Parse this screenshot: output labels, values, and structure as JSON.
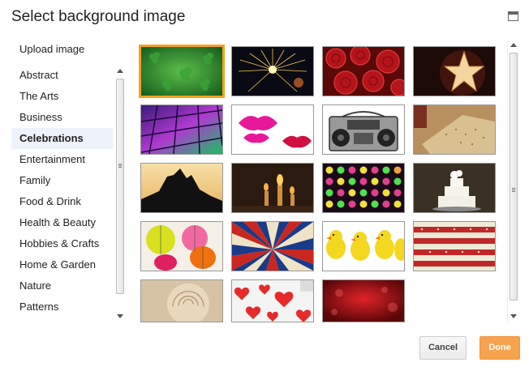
{
  "dialog": {
    "title": "Select background image",
    "upload_label": "Upload image"
  },
  "categories": [
    {
      "label": "Abstract"
    },
    {
      "label": "The Arts"
    },
    {
      "label": "Business"
    },
    {
      "label": "Celebrations",
      "selected": true
    },
    {
      "label": "Entertainment"
    },
    {
      "label": "Family"
    },
    {
      "label": "Food & Drink"
    },
    {
      "label": "Health & Beauty"
    },
    {
      "label": "Hobbies & Crafts"
    },
    {
      "label": "Home & Garden"
    },
    {
      "label": "Nature"
    },
    {
      "label": "Patterns"
    }
  ],
  "images": [
    {
      "name": "shamrock-image",
      "selected": true
    },
    {
      "name": "fireworks-image"
    },
    {
      "name": "red-roses-image"
    },
    {
      "name": "star-lantern-image"
    },
    {
      "name": "disco-floor-image"
    },
    {
      "name": "lipstick-kisses-image"
    },
    {
      "name": "boombox-image"
    },
    {
      "name": "matzah-image"
    },
    {
      "name": "mountain-silhouette-image"
    },
    {
      "name": "candles-image"
    },
    {
      "name": "party-lights-image"
    },
    {
      "name": "wedding-cake-image"
    },
    {
      "name": "paper-lanterns-image"
    },
    {
      "name": "sunburst-stripes-image"
    },
    {
      "name": "chicks-image"
    },
    {
      "name": "stars-stripes-image"
    },
    {
      "name": "cream-rose-image"
    },
    {
      "name": "hearts-image"
    },
    {
      "name": "red-bokeh-image"
    }
  ],
  "buttons": {
    "cancel": "Cancel",
    "done": "Done"
  },
  "colors": {
    "accent": "#f4a31b",
    "done_button": "#f6a24f",
    "selected_category_bg": "#eef3fb"
  }
}
